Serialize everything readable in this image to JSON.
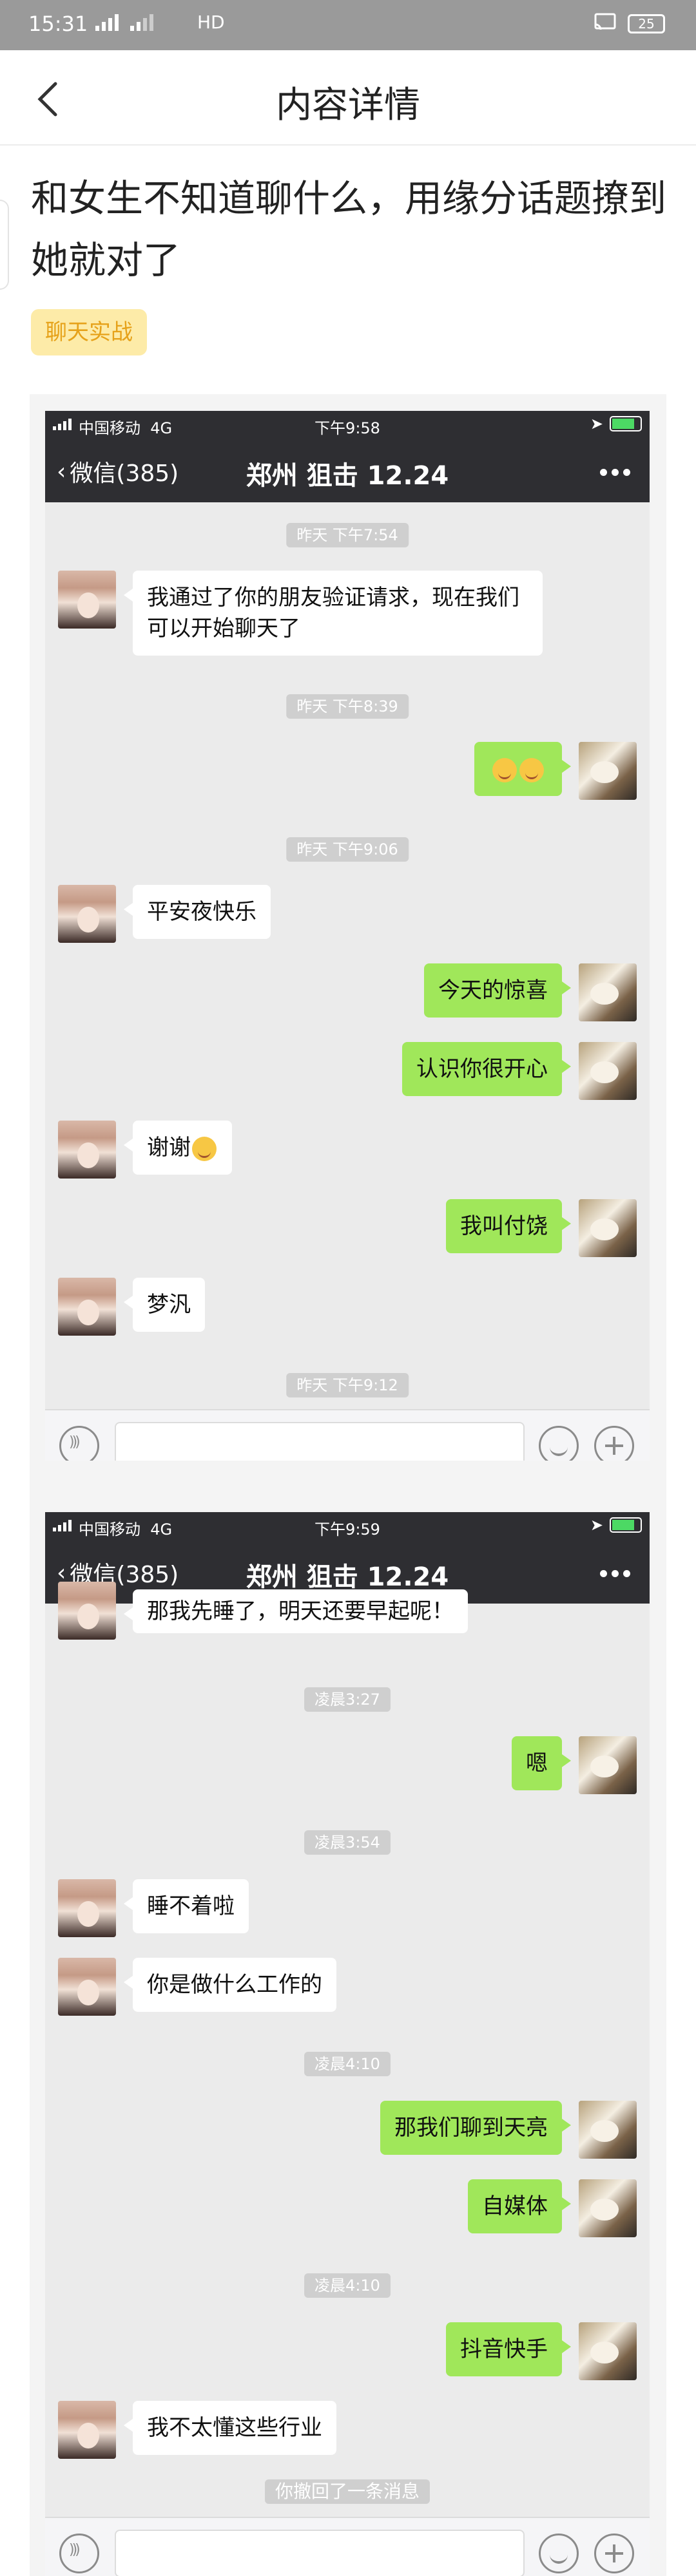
{
  "status_bar": {
    "time": "15:31",
    "network": "HD",
    "battery": "25"
  },
  "header": {
    "title": "内容详情"
  },
  "article": {
    "title": "和女生不知道聊什么，用缘分话题撩到她就对了",
    "tag": "聊天实战"
  },
  "shot1": {
    "carrier": "中国移动",
    "net": "4G",
    "clock": "下午9:58",
    "back_label": "微信(385)",
    "chat_title": "郑州 狙击 12.24",
    "times": [
      "昨天 下午7:54",
      "昨天 下午8:39",
      "昨天 下午9:06",
      "昨天 下午9:12"
    ],
    "messages": [
      "我通过了你的朋友验证请求，现在我们可以开始聊天了",
      "平安夜快乐",
      "今天的惊喜",
      "认识你很开心",
      "谢谢",
      "我叫付饶",
      "梦汎"
    ]
  },
  "shot2": {
    "carrier": "中国移动",
    "net": "4G",
    "clock": "下午9:59",
    "back_label": "微信(385)",
    "chat_title": "郑州 狙击 12.24",
    "times": [
      "凌晨3:27",
      "凌晨3:54",
      "凌晨4:10",
      "凌晨4:10"
    ],
    "messages": [
      "那我先睡了，明天还要早起呢！",
      "嗯",
      "睡不着啦",
      "你是做什么工作的",
      "那我们聊到天亮",
      "自媒体",
      "抖音快手",
      "我不太懂这些行业"
    ],
    "recall_notice": "你撤回了一条消息"
  }
}
